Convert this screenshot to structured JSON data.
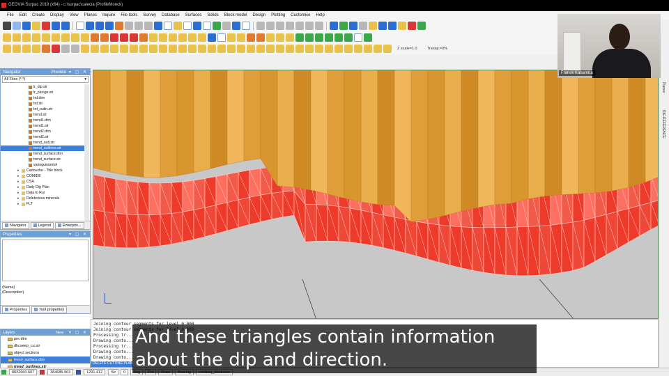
{
  "window": {
    "title": "GEOVIA Surpac 2019 (x64) - c:\\surpac\\calecia (ProfileMonck)"
  },
  "menu": [
    "File",
    "Edit",
    "Create",
    "Display",
    "View",
    "Planes",
    "Inquire",
    "File tools",
    "Survey",
    "Database",
    "Surfaces",
    "Solids",
    "Block model",
    "Design",
    "Plotting",
    "Customise",
    "Help"
  ],
  "toolbar": {
    "zscale": "Z scale=1.0",
    "transparency": "Transp.=0%"
  },
  "navigator": {
    "title": "Navigator",
    "preview": "Preview",
    "filter": "All Files (*.*)",
    "items": [
      {
        "label": "lr_dip.str",
        "type": "file",
        "indent": 5
      },
      {
        "label": "lr_plunge.str",
        "type": "file",
        "indent": 5
      },
      {
        "label": "trd.dtm",
        "type": "file",
        "indent": 5
      },
      {
        "label": "trd.str",
        "type": "file",
        "indent": 5
      },
      {
        "label": "trd_outln.str",
        "type": "file",
        "indent": 5
      },
      {
        "label": "trend.str",
        "type": "file",
        "indent": 5
      },
      {
        "label": "trend1.dtm",
        "type": "file",
        "indent": 5
      },
      {
        "label": "trend1.str",
        "type": "file",
        "indent": 5
      },
      {
        "label": "trend2.dtm",
        "type": "file",
        "indent": 5
      },
      {
        "label": "trend2.str",
        "type": "file",
        "indent": 5
      },
      {
        "label": "trend_outl.str",
        "type": "file",
        "indent": 5
      },
      {
        "label": "trend_outlines.str",
        "type": "file",
        "indent": 5,
        "selected": true
      },
      {
        "label": "trend_surface.dtm",
        "type": "file",
        "indent": 5
      },
      {
        "label": "trend_surface.str",
        "type": "file",
        "indent": 5
      },
      {
        "label": "varioguinumtot",
        "type": "file",
        "indent": 5
      },
      {
        "label": "Cartouche - Title block",
        "type": "folder",
        "indent": 3
      },
      {
        "label": "COMIDE",
        "type": "folder",
        "indent": 3
      },
      {
        "label": "CSA",
        "type": "folder",
        "indent": 3
      },
      {
        "label": "Daily Dig Plan",
        "type": "folder",
        "indent": 3
      },
      {
        "label": "Data to Rui",
        "type": "folder",
        "indent": 3
      },
      {
        "label": "Deleterious minerals",
        "type": "folder",
        "indent": 3
      },
      {
        "label": "FLT",
        "type": "folder",
        "indent": 3
      }
    ],
    "tabs": [
      "Navigator",
      "Legend",
      "Enterpris..."
    ]
  },
  "properties": {
    "title": "Properties",
    "fields": [
      "(Name)",
      "(Description)"
    ],
    "tabs": [
      "Properties",
      "Tool properties"
    ]
  },
  "layers": {
    "title": "Layers",
    "new_label": "New",
    "items": [
      {
        "label": "pre.dtm",
        "selected": false,
        "bold": false
      },
      {
        "label": "dhcseep_cu.str",
        "selected": false,
        "bold": false
      },
      {
        "label": "object sections",
        "selected": false,
        "bold": false
      },
      {
        "label": "trend_surface.dtm",
        "selected": true,
        "bold": false
      },
      {
        "label": "trend_outlines.str",
        "selected": false,
        "bold": true
      }
    ]
  },
  "console": {
    "lines": [
      "Joining contour segments for level 0.000",
      "Joining contour segments for level 0.000",
      "Processing tr...",
      "Drawing conto...",
      "Processing tr...",
      "Drawing conto...",
      "Drawing conto..."
    ],
    "command": "DELETE CUTTING PLANE"
  },
  "right_tabs": [
    "Planes",
    "IDE-REFERENCE"
  ],
  "status": {
    "y": "8822660.607",
    "x": "384686.903",
    "z": "1291.412",
    "fields": [
      "Str",
      "0",
      "Seg",
      "Pnt",
      "Draw",
      "Bearing",
      "cmdseq_database"
    ]
  },
  "webcam": {
    "name": "Franck Kabamba"
  },
  "caption": {
    "line1": "And these triangles contain information",
    "line2": "about the dip and direction."
  },
  "colors": {
    "surface_orange": "#e0a640",
    "triangles_red": "#ee3a2a",
    "selection": "#3d7fd6",
    "panel_header": "#6e9ed6"
  }
}
